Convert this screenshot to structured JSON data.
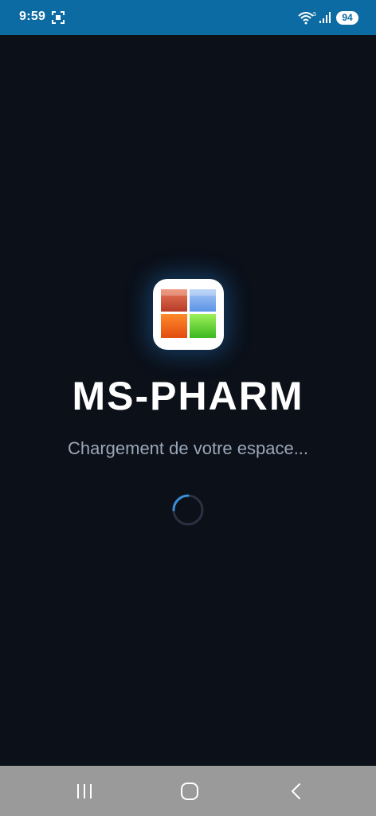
{
  "status_bar": {
    "time": "9:59",
    "battery": "94",
    "icons": [
      "screenshot-icon",
      "wifi-icon",
      "signal-icon"
    ]
  },
  "splash": {
    "app_name": "MS-PHARM",
    "loading_message": "Chargement de votre espace...",
    "logo_icon": "four-color-grid-logo",
    "spinner_icon": "loading-spinner"
  },
  "nav_bar": {
    "buttons": [
      "recent-apps-icon",
      "home-icon",
      "back-icon"
    ]
  },
  "colors": {
    "background": "#0b1019",
    "status_bar": "#0d6ba3",
    "nav_bar": "#9a9a9a",
    "title": "#ffffff",
    "subtitle": "#9ba7b8",
    "spinner_accent": "#3b8fd6"
  }
}
